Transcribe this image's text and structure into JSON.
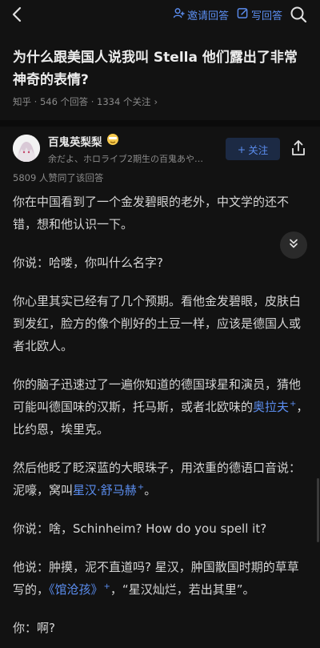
{
  "topbar": {
    "invite_label": "邀请回答",
    "write_label": "写回答"
  },
  "question": {
    "title": "为什么跟美国人说我叫 Stella 他们露出了非常神奇的表情?",
    "meta": "知乎 · 546 个回答 · 1334 个关注",
    "meta_arrow": "›"
  },
  "author": {
    "name": "百鬼英梨梨",
    "bio": "余だよ、ホロライブ2期生の百鬼あや…",
    "follow_label": "关注",
    "follow_plus": "+"
  },
  "upvotes": "5809 人赞同了该回答",
  "answer": {
    "p1": "你在中国看到了一个金发碧眼的老外，中文学的还不错，想和他认识一下。",
    "p2": "你说：哈喽，你叫什么名字?",
    "p3": "你心里其实已经有了几个预期。看他金发碧眼，皮肤白到发红，脸方的像个削好的土豆一样，应该是德国人或者北欧人。",
    "p4_a": "你的脑子迅速过了一遍你知道的德国球星和演员，猜他可能叫德国味的汉斯，托马斯，或者北欧味的",
    "p4_link": "奥拉夫",
    "p4_b": "，比约恩，埃里克。",
    "p5_a": "然后他眨了眨深蓝的大眼珠子，用浓重的德语口音说：泥嚎，窝叫",
    "p5_link": "星汉·舒马赫",
    "p5_b": "。",
    "p6": "你说：啥，Schinheim?  How do you spell it?",
    "p7_a": "他说：肿摸，泥不直道吗? 星汉，肿国散国时期的草草写的，",
    "p7_link": "《馆沧孩》",
    "p7_b": "，“星汉灿烂，若出其里”。",
    "p8": "你：啊?",
    "sup_mark": "+"
  },
  "colors": {
    "background": "#121212",
    "accent": "#5b8def",
    "text": "#d5d5d5",
    "muted": "#8a8a8a"
  },
  "icons": [
    "back-icon",
    "invite-icon",
    "pen-icon",
    "search-icon",
    "share-icon",
    "double-chevron-down-icon",
    "emoji-badge-icon"
  ]
}
